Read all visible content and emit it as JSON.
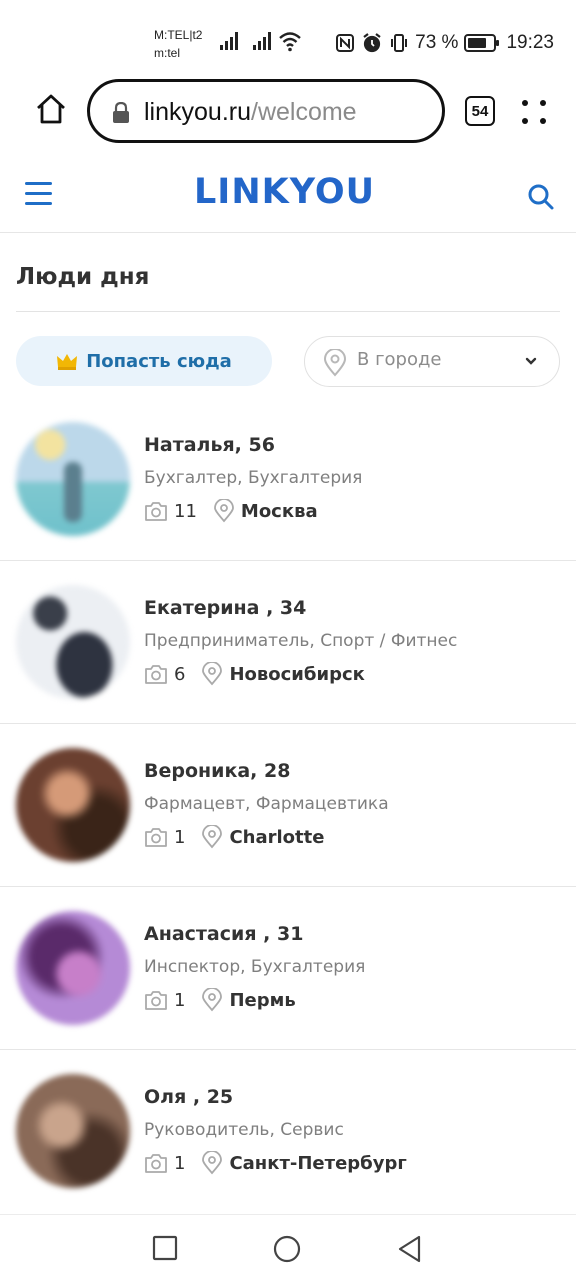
{
  "status_bar": {
    "carrier_line1": "M:TEL|t2",
    "carrier_line2": "m:tel",
    "battery_percent": "73 %",
    "battery_level": 0.73,
    "time": "19:23"
  },
  "browser": {
    "url_domain": "linkyou.ru",
    "url_path": "/welcome",
    "tab_count": "54"
  },
  "site": {
    "logo": "LINKYOU"
  },
  "section": {
    "title": "Люди дня",
    "promo_label": "Попасть сюда",
    "city_placeholder": "В городе"
  },
  "people": [
    {
      "name": "Наталья, 56",
      "job": "Бухгалтер, Бухгалтерия",
      "photos": "11",
      "city": "Москва"
    },
    {
      "name": "Екатерина , 34",
      "job": "Предприниматель, Спорт / Фитнес",
      "photos": "6",
      "city": "Новосибирск"
    },
    {
      "name": "Вероника, 28",
      "job": "Фармацевт, Фармацевтика",
      "photos": "1",
      "city": "Charlotte"
    },
    {
      "name": "Анастасия , 31",
      "job": "Инспектор, Бухгалтерия",
      "photos": "1",
      "city": "Пермь"
    },
    {
      "name": "Оля , 25",
      "job": "Руководитель, Сервис",
      "photos": "1",
      "city": "Санкт-Петербург"
    }
  ],
  "colors": {
    "brand": "#2366c9",
    "promo_bg": "#e9f3fb",
    "promo_text": "#1f6ea8",
    "crown": "#f2b705"
  }
}
